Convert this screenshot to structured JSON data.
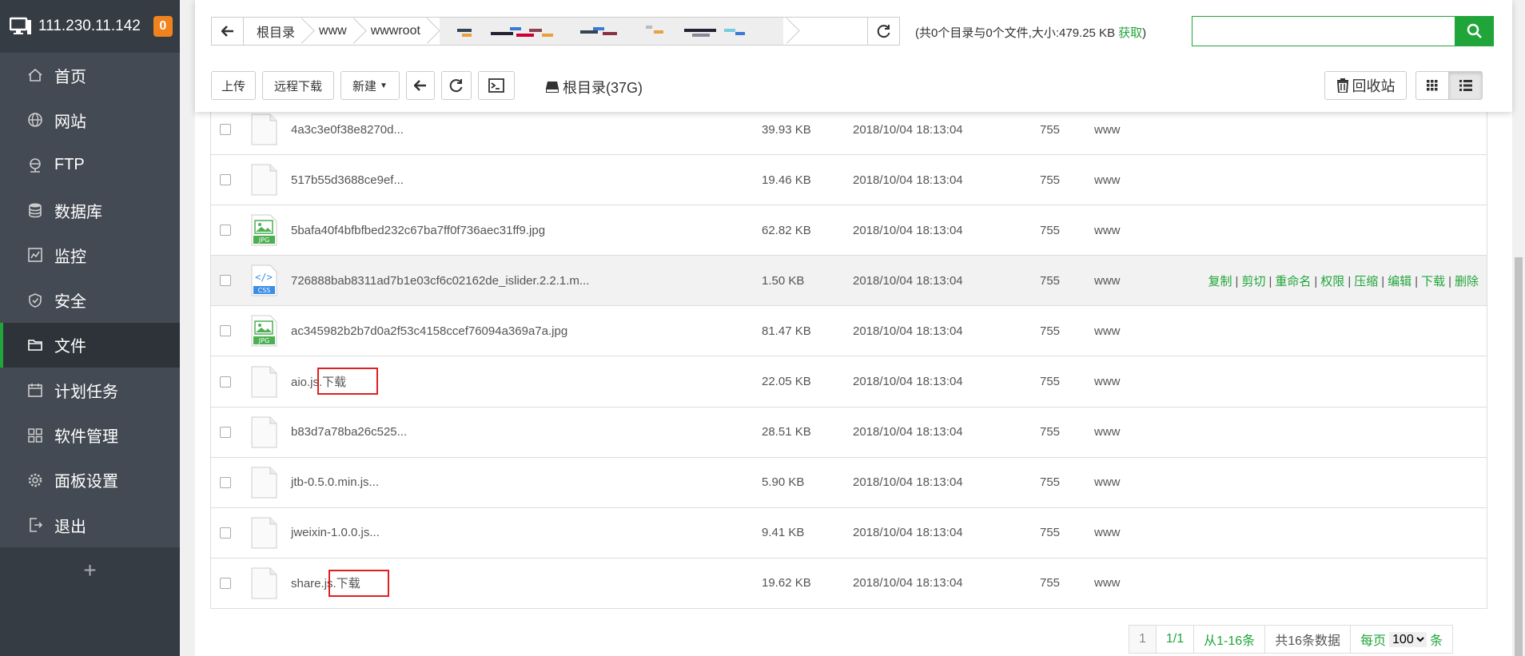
{
  "server": {
    "ip": "111.230.11.142",
    "badge": "0"
  },
  "menu": [
    {
      "label": "首页",
      "icon": "home-icon"
    },
    {
      "label": "网站",
      "icon": "globe-icon"
    },
    {
      "label": "FTP",
      "icon": "ftp-icon"
    },
    {
      "label": "数据库",
      "icon": "database-icon"
    },
    {
      "label": "监控",
      "icon": "monitor-chart-icon"
    },
    {
      "label": "安全",
      "icon": "shield-icon"
    },
    {
      "label": "文件",
      "icon": "folder-icon",
      "active": true
    },
    {
      "label": "计划任务",
      "icon": "calendar-icon"
    },
    {
      "label": "软件管理",
      "icon": "grid-icon"
    },
    {
      "label": "面板设置",
      "icon": "gear-icon"
    },
    {
      "label": "退出",
      "icon": "logout-icon"
    }
  ],
  "sidebar_plus": "+",
  "path": {
    "crumbs": [
      "根目录",
      "www",
      "wwwroot"
    ]
  },
  "dir_info": {
    "text": "(共0个目录与0个文件,大小:479.25 KB",
    "get": "获取",
    "close": ")"
  },
  "toolbar": {
    "upload": "上传",
    "remote_download": "远程下载",
    "new": "新建",
    "root_disk": "根目录(37G)",
    "recycle": "回收站"
  },
  "files": [
    {
      "name": "4a3c3e0f38e8270d...",
      "type": "file",
      "size": "39.93 KB",
      "date": "2018/10/04 18:13:04",
      "perm": "755",
      "owner": "www"
    },
    {
      "name": "517b55d3688ce9ef...",
      "type": "file",
      "size": "19.46 KB",
      "date": "2018/10/04 18:13:04",
      "perm": "755",
      "owner": "www"
    },
    {
      "name": "5bafa40f4bfbfbed232c67ba7ff0f736aec31ff9.jpg",
      "type": "jpg",
      "size": "62.82 KB",
      "date": "2018/10/04 18:13:04",
      "perm": "755",
      "owner": "www"
    },
    {
      "name": "726888bab8311ad7b1e03cf6c02162de_islider.2.2.1.m...",
      "type": "css",
      "size": "1.50 KB",
      "date": "2018/10/04 18:13:04",
      "perm": "755",
      "owner": "www",
      "hover": true
    },
    {
      "name": "ac345982b2b7d0a2f53c4158ccef76094a369a7a.jpg",
      "type": "jpg",
      "size": "81.47 KB",
      "date": "2018/10/04 18:13:04",
      "perm": "755",
      "owner": "www"
    },
    {
      "name": "aio.js.下载",
      "type": "file",
      "size": "22.05 KB",
      "date": "2018/10/04 18:13:04",
      "perm": "755",
      "owner": "www",
      "highlight": true
    },
    {
      "name": "b83d7a78ba26c525...",
      "type": "file",
      "size": "28.51 KB",
      "date": "2018/10/04 18:13:04",
      "perm": "755",
      "owner": "www"
    },
    {
      "name": "jtb-0.5.0.min.js...",
      "type": "file",
      "size": "5.90 KB",
      "date": "2018/10/04 18:13:04",
      "perm": "755",
      "owner": "www"
    },
    {
      "name": "jweixin-1.0.0.js...",
      "type": "file",
      "size": "9.41 KB",
      "date": "2018/10/04 18:13:04",
      "perm": "755",
      "owner": "www"
    },
    {
      "name": "share.js.下载",
      "type": "file",
      "size": "19.62 KB",
      "date": "2018/10/04 18:13:04",
      "perm": "755",
      "owner": "www",
      "highlight": true
    }
  ],
  "row_actions": [
    "复制",
    "剪切",
    "重命名",
    "权限",
    "压缩",
    "编辑",
    "下载",
    "删除"
  ],
  "pager": {
    "page": "1",
    "pages": "1/1",
    "range": "从1-16条",
    "total": "共16条数据",
    "per_page_label": "每页",
    "per_page": "100",
    "unit": "条"
  },
  "colors": {
    "accent": "#20a53a",
    "sidebar": "#434a53",
    "badge": "#f0831e",
    "redbox": "#e02020"
  }
}
